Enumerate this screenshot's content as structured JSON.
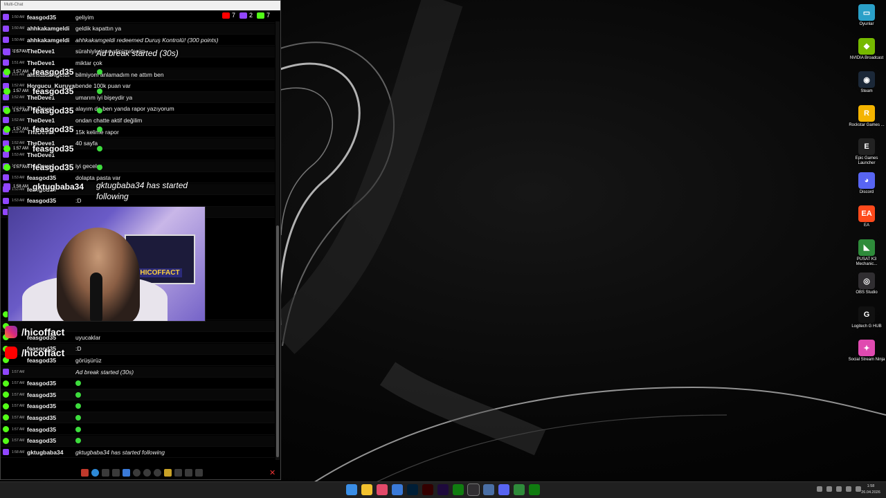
{
  "window": {
    "title": "Multi-Chat"
  },
  "counters": [
    {
      "platform": "youtube",
      "value": "7",
      "color": "#ff0000"
    },
    {
      "platform": "twitch",
      "value": "2",
      "color": "#9146ff"
    },
    {
      "platform": "kick",
      "value": "7",
      "color": "#53fc18"
    }
  ],
  "chat": [
    {
      "platform": "twitch",
      "time": "1:50 AM",
      "user": "feasgod35",
      "msg": "geliyim",
      "italic": false
    },
    {
      "platform": "twitch",
      "time": "1:50 AM",
      "user": "ahhkakamgeldi",
      "msg": "geldik kapattın ya",
      "italic": false
    },
    {
      "platform": "twitch",
      "time": "1:50 AM",
      "user": "ahhkakamgeldi",
      "msg": "ahhkakamgeldi redeemed Duruş Kontrolü! (300 points)",
      "italic": true
    },
    {
      "platform": "twitch",
      "time": "1:51 AM",
      "user": "TheDeve1",
      "msg": "sürahiyle içseydiniz efenim",
      "italic": false
    },
    {
      "platform": "twitch",
      "time": "1:51 AM",
      "user": "TheDeve1",
      "msg": "miktar çok",
      "italic": false
    },
    {
      "platform": "twitch",
      "time": "1:51 AM",
      "user": "ahhkakamgeldi",
      "msg": "bilmiyom anlamadım ne attım ben",
      "italic": false
    },
    {
      "platform": "twitch",
      "time": "1:52 AM",
      "user": "Horgucu_Kuruyan_Deve",
      "msg": "bende 100k puan var",
      "italic": false
    },
    {
      "platform": "twitch",
      "time": "1:52 AM",
      "user": "TheDeve1",
      "msg": "umarım iyi bişeydir ya",
      "italic": false
    },
    {
      "platform": "twitch",
      "time": "1:52 AM",
      "user": "TheDeve1",
      "msg": "alayım da ben yanda rapor yazıyorum",
      "italic": false
    },
    {
      "platform": "twitch",
      "time": "1:52 AM",
      "user": "TheDeve1",
      "msg": "ondan chatte aktif değilim",
      "italic": false
    },
    {
      "platform": "twitch",
      "time": "1:52 AM",
      "user": "TheDeve1",
      "msg": "15k kelime rapor",
      "italic": false
    },
    {
      "platform": "twitch",
      "time": "1:52 AM",
      "user": "TheDeve1",
      "msg": "40 sayfa",
      "italic": false
    },
    {
      "platform": "twitch",
      "time": "1:53 AM",
      "user": "TheDeve1",
      "msg": "",
      "italic": false
    },
    {
      "platform": "twitch",
      "time": "1:53 AM",
      "user": "TheDeve1",
      "msg": "iyi geceler",
      "italic": false
    },
    {
      "platform": "twitch",
      "time": "1:53 AM",
      "user": "feasgod35",
      "msg": "dolapta pasta var",
      "italic": false
    },
    {
      "platform": "twitch",
      "time": "1:53 AM",
      "user": "feasgod35",
      "msg": "",
      "italic": false
    },
    {
      "platform": "twitch",
      "time": "1:53 AM",
      "user": "feasgod35",
      "msg": ":D",
      "italic": false
    },
    {
      "platform": "twitch",
      "time": "1:53 AM",
      "user": "TheDeve1",
      "msg": "",
      "italic": false
    }
  ],
  "chat_bottom": [
    {
      "platform": "kick",
      "time": "",
      "user": "feasgod35",
      "msg": "ab,",
      "italic": false
    },
    {
      "platform": "kick",
      "time": "",
      "user": "",
      "msg": "",
      "italic": false
    },
    {
      "platform": "kick",
      "time": "",
      "user": "feasgod35",
      "msg": "uyucaklar",
      "italic": false
    },
    {
      "platform": "kick",
      "time": "",
      "user": "feasgod35",
      "msg": ":D",
      "italic": false
    },
    {
      "platform": "kick",
      "time": "",
      "user": "feasgod35",
      "msg": "görüşürüz",
      "italic": false
    },
    {
      "platform": "twitch",
      "time": "1:57 AM",
      "user": "",
      "msg": "Ad break started (30s)",
      "italic": true
    },
    {
      "platform": "kick",
      "time": "1:57 AM",
      "user": "feasgod35",
      "msg": "emote",
      "italic": false
    },
    {
      "platform": "kick",
      "time": "1:57 AM",
      "user": "feasgod35",
      "msg": "emote",
      "italic": false
    },
    {
      "platform": "kick",
      "time": "1:57 AM",
      "user": "feasgod35",
      "msg": "emote",
      "italic": false
    },
    {
      "platform": "kick",
      "time": "1:57 AM",
      "user": "feasgod35",
      "msg": "emote",
      "italic": false
    },
    {
      "platform": "kick",
      "time": "1:57 AM",
      "user": "feasgod35",
      "msg": "emote",
      "italic": false
    },
    {
      "platform": "kick",
      "time": "1:57 AM",
      "user": "feasgod35",
      "msg": "emote",
      "italic": false
    },
    {
      "platform": "twitch",
      "time": "1:58 AM",
      "user": "gktugbaba34",
      "msg": "gktugbaba34 has started following",
      "italic": true
    }
  ],
  "overlay": {
    "ad_time": "1:57 AM",
    "ad_text": "Ad break started (30s)",
    "kick_time": "1:57 AM",
    "kick_user": "feasgod35",
    "follow_time": "1:58 AM",
    "follow_user": "gktugbaba34",
    "follow_text": "gktugbaba34 has started following",
    "stream_logo": "HICOFFACT",
    "instagram": "/hicoffact",
    "youtube": "/hicoffact"
  },
  "desktop_icons": [
    {
      "name": "desk-icon-oyunlar",
      "label": "Oyunlar",
      "color": "#2aa0c8",
      "glyph": "▭"
    },
    {
      "name": "desk-icon-nvidia",
      "label": "NVIDIA Broadcast",
      "color": "#76b900",
      "glyph": "◆"
    },
    {
      "name": "desk-icon-steam",
      "label": "Steam",
      "color": "#1b2838",
      "glyph": "◉"
    },
    {
      "name": "desk-icon-rockstar",
      "label": "Rockstar Games ...",
      "color": "#f4b400",
      "glyph": "R"
    },
    {
      "name": "desk-icon-epic",
      "label": "Epic Games Launcher",
      "color": "#222222",
      "glyph": "E"
    },
    {
      "name": "desk-icon-discord",
      "label": "Discord",
      "color": "#5865f2",
      "glyph": "◕"
    },
    {
      "name": "desk-icon-ea",
      "label": "EA",
      "color": "#ff4a1c",
      "glyph": "EA"
    },
    {
      "name": "desk-icon-pusat",
      "label": "PUSAT K3 Mechanic...",
      "color": "#2e8b3a",
      "glyph": "◣"
    },
    {
      "name": "desk-icon-obs",
      "label": "OBS Studio",
      "color": "#302e31",
      "glyph": "◎"
    },
    {
      "name": "desk-icon-logitech",
      "label": "Logitech G HUB",
      "color": "#111111",
      "glyph": "G"
    },
    {
      "name": "desk-icon-ssn",
      "label": "Social Stream Ninja",
      "color": "#e04ab0",
      "glyph": "✦"
    }
  ],
  "taskbar": {
    "apps": [
      {
        "name": "taskbar-start",
        "color": "#3a8ee6"
      },
      {
        "name": "taskbar-explorer",
        "color": "#f2c12e"
      },
      {
        "name": "taskbar-app-red",
        "color": "#e24a6a"
      },
      {
        "name": "taskbar-app-blue",
        "color": "#3a7ad8"
      },
      {
        "name": "taskbar-photoshop",
        "color": "#001e36"
      },
      {
        "name": "taskbar-illustrator",
        "color": "#330000"
      },
      {
        "name": "taskbar-premiere",
        "color": "#1e0a3c"
      },
      {
        "name": "taskbar-xbox",
        "color": "#107c10"
      },
      {
        "name": "taskbar-obs",
        "color": "#302e31",
        "active": true
      },
      {
        "name": "taskbar-app-gear",
        "color": "#4a6fa5"
      },
      {
        "name": "taskbar-discord",
        "color": "#5865f2"
      },
      {
        "name": "taskbar-app-green",
        "color": "#2e8b3a"
      },
      {
        "name": "taskbar-xbox2",
        "color": "#107c10"
      }
    ],
    "time": "1:58",
    "date": "26.04.2026"
  }
}
